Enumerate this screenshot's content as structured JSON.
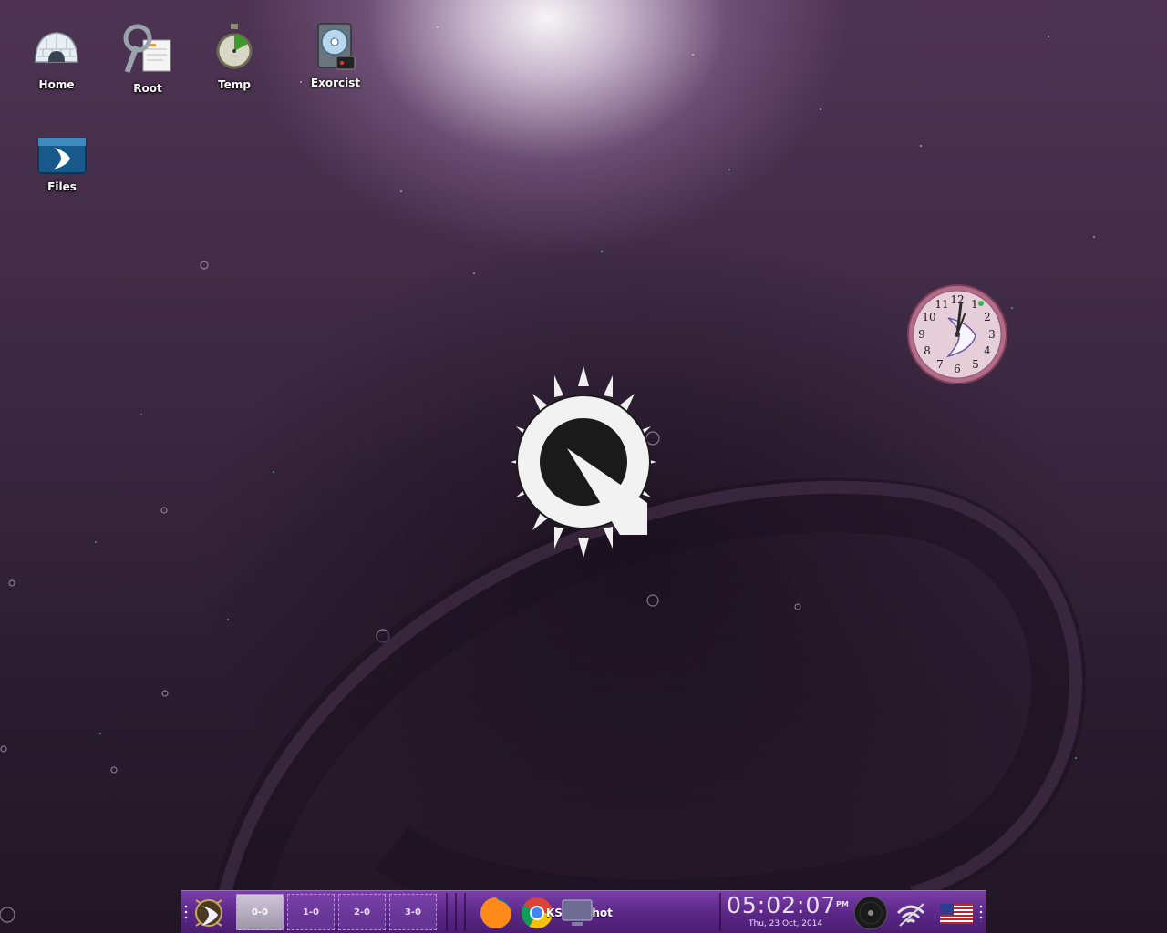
{
  "desktop": {
    "icons": [
      {
        "label": "Home"
      },
      {
        "label": "Root"
      },
      {
        "label": "Temp"
      },
      {
        "label": "Exorcist"
      },
      {
        "label": "Files"
      }
    ]
  },
  "clock_widget": {
    "numerals": [
      "12",
      "1",
      "2",
      "3",
      "4",
      "5",
      "6",
      "7",
      "8",
      "9",
      "10",
      "11"
    ]
  },
  "taskbar": {
    "pager": [
      {
        "label": "0-0",
        "active": true
      },
      {
        "label": "1-0",
        "active": false
      },
      {
        "label": "2-0",
        "active": false
      },
      {
        "label": "3-0",
        "active": false
      }
    ],
    "active_task_label": "KSnapshot",
    "clock": {
      "time": "05:02:07",
      "ampm": "PM",
      "date": "Thu, 23 Oct, 2014"
    }
  },
  "colors": {
    "taskbar": "#5a2786",
    "accent": "#9b6cc5",
    "clock_rim": "#b36b8a"
  },
  "icon_names": [
    "igloo-home-icon",
    "root-tools-icon",
    "stopwatch-temp-icon",
    "hard-drive-exorcist-icon",
    "files-folder-icon",
    "enlightenment-menu-icon",
    "firefox-icon",
    "chrome-icon",
    "monitor-icon",
    "media-disc-icon",
    "wifi-icon",
    "us-flag-icon"
  ]
}
